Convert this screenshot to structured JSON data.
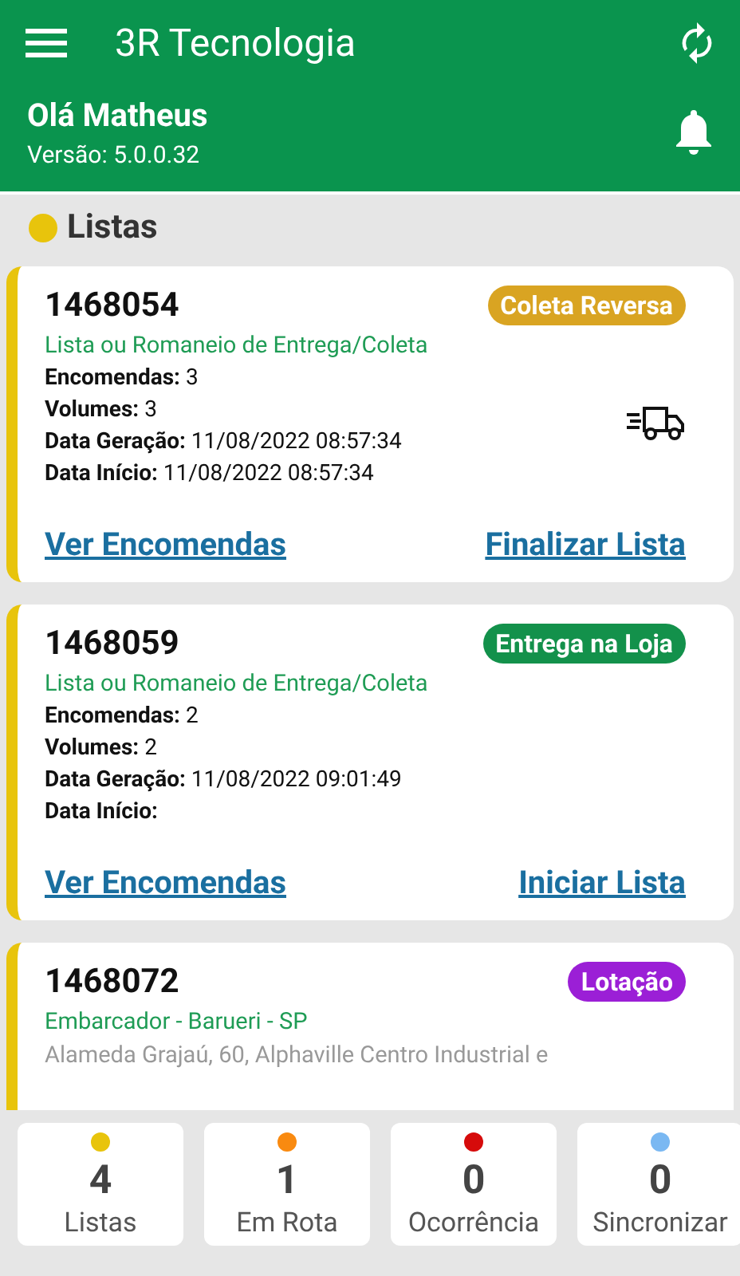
{
  "app_bar": {
    "title": "3R Tecnologia"
  },
  "greeting": {
    "name": "Olá Matheus",
    "version": "Versão: 5.0.0.32"
  },
  "section": {
    "title": "Listas",
    "color": "#e8c40c"
  },
  "cards": [
    {
      "number": "1468054",
      "badge": {
        "text": "Coleta Reversa",
        "color": "#d9a422"
      },
      "subtitle": "Lista ou Romaneio de Entrega/Coleta",
      "in_route": true,
      "details": [
        {
          "kind": "field",
          "text": "**Encomendas:** 3"
        },
        {
          "kind": "field",
          "text": "**Volumes:** 3"
        },
        {
          "kind": "field",
          "text": "**Data Geração:** 11/08/2022 08:57:34"
        },
        {
          "kind": "field",
          "text": "**Data Início:** 11/08/2022 08:57:34"
        }
      ],
      "actions": [
        "Ver Encomendas",
        "Finalizar Lista"
      ]
    },
    {
      "number": "1468059",
      "badge": {
        "text": "Entrega na Loja",
        "color": "#13914b"
      },
      "subtitle": "Lista ou Romaneio de Entrega/Coleta",
      "in_route": false,
      "details": [
        {
          "kind": "field",
          "text": "**Encomendas:** 2"
        },
        {
          "kind": "field",
          "text": "**Volumes:** 2"
        },
        {
          "kind": "field",
          "text": "**Data Geração:** 11/08/2022 09:01:49"
        },
        {
          "kind": "field",
          "text": "**Data Início:**"
        }
      ],
      "actions": [
        "Ver Encomendas",
        "Iniciar Lista"
      ]
    },
    {
      "number": "1468072",
      "badge": {
        "text": "Lotação",
        "color": "#9b1fd6"
      },
      "subtitle": "Embarcador - Barueri - SP",
      "in_route": false,
      "details": [
        {
          "kind": "address",
          "text": "Alameda Grajaú, 60, Alphaville Centro Industrial e"
        }
      ]
    }
  ],
  "summary": [
    {
      "count": "4",
      "label": "Listas",
      "color": "#e8c40c"
    },
    {
      "count": "1",
      "label": "Em Rota",
      "color": "#f98a10"
    },
    {
      "count": "0",
      "label": "Ocorrência",
      "color": "#d60b0b"
    },
    {
      "count": "0",
      "label": "Sincronizar",
      "color": "#7ab8f2"
    }
  ]
}
